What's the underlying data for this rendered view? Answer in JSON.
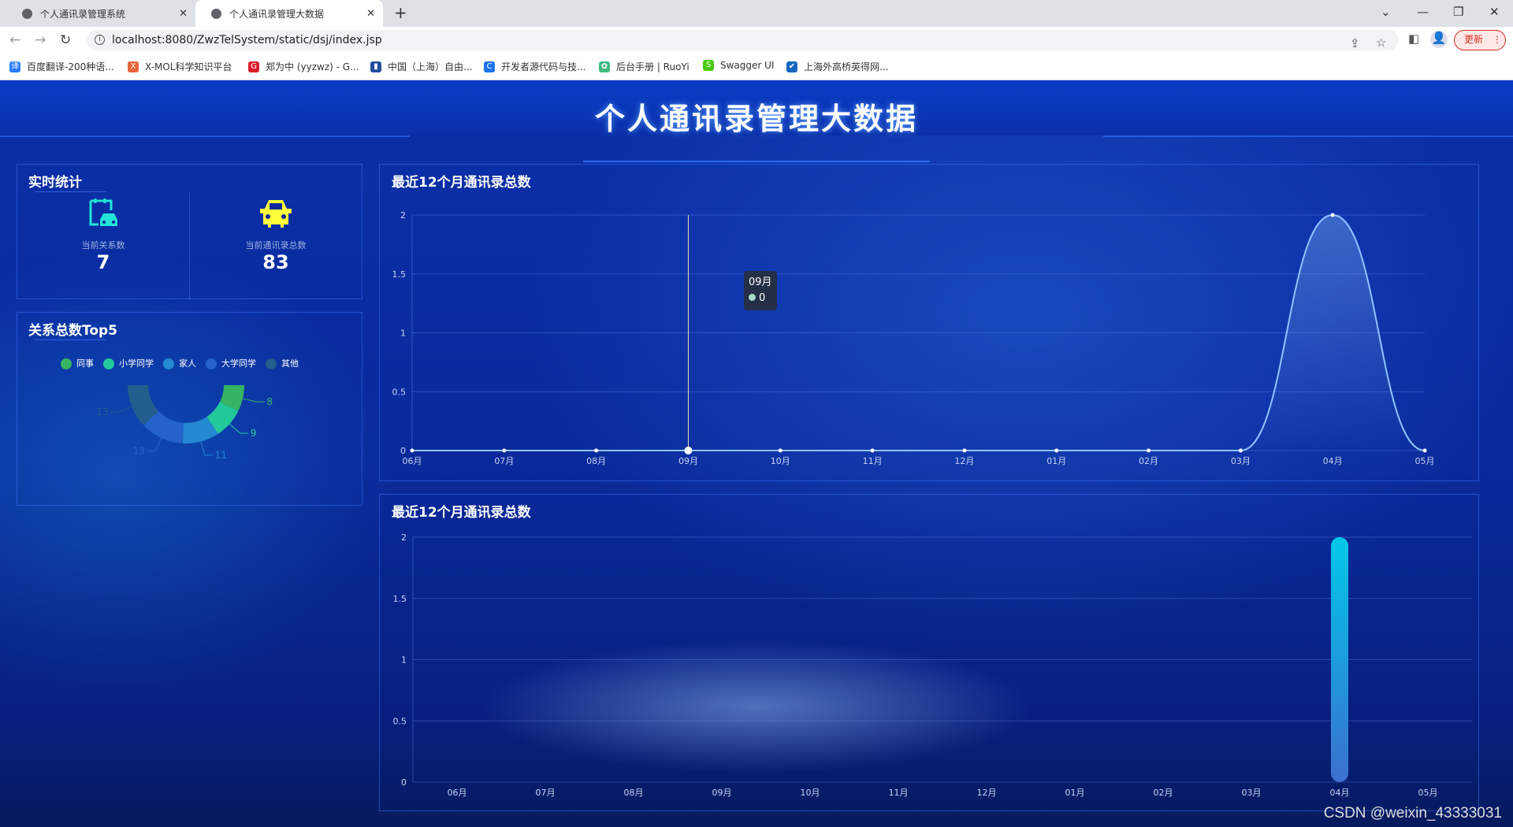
{
  "browser": {
    "tabs": [
      {
        "title": "个人通讯录管理系统",
        "active": false
      },
      {
        "title": "个人通讯录管理大数据",
        "active": true
      }
    ],
    "url": "localhost:8080/ZwzTelSystem/static/dsj/index.jsp",
    "update_label": "更新",
    "bookmarks": [
      {
        "label": "百度翻译-200种语...",
        "icon": "译",
        "color": "#2a7cf7"
      },
      {
        "label": "X-MOL科学知识平台",
        "icon": "X",
        "color": "#e8643c"
      },
      {
        "label": "郑为中 (yyzwz) - G...",
        "icon": "G",
        "color": "#d81e2c"
      },
      {
        "label": "中国（上海）自由...",
        "icon": "▮",
        "color": "#1f4e9c"
      },
      {
        "label": "开发者源代码与技...",
        "icon": "C",
        "color": "#1a73e8"
      },
      {
        "label": "后台手册 | RuoYi",
        "icon": "✿",
        "color": "#42b983"
      },
      {
        "label": "Swagger UI",
        "icon": "S",
        "color": "#49cc0c"
      },
      {
        "label": "上海外高桥英得网...",
        "icon": "✔",
        "color": "#1565c0"
      }
    ]
  },
  "page": {
    "title": "个人通讯录管理大数据",
    "realtime": {
      "title": "实时统计",
      "stats": [
        {
          "label": "当前关系数",
          "value": "7",
          "icon": "clipboard-car-icon",
          "color": "#22e3d6"
        },
        {
          "label": "当前通讯录总数",
          "value": "83",
          "icon": "car-icon",
          "color": "#ffff3c"
        }
      ]
    },
    "top5": {
      "title": "关系总数Top5"
    },
    "line_panel_title": "最近12个月通讯录总数",
    "bar_panel_title": "最近12个月通讯录总数",
    "tooltip": {
      "category": "09月",
      "value": "0"
    },
    "watermark": "CSDN @weixin_43333031"
  },
  "chart_data": [
    {
      "type": "pie",
      "variant": "half-donut",
      "legend_position": "top",
      "categories": [
        "同事",
        "小学同学",
        "家人",
        "大学同学",
        "其他"
      ],
      "values": [
        8,
        9,
        11,
        13,
        13
      ],
      "colors": [
        "#35b464",
        "#22c99a",
        "#2389d0",
        "#2562cc",
        "#235e8c"
      ]
    },
    {
      "type": "line",
      "smooth": true,
      "area": true,
      "categories": [
        "06月",
        "07月",
        "08月",
        "09月",
        "10月",
        "11月",
        "12月",
        "01月",
        "02月",
        "03月",
        "04月",
        "05月"
      ],
      "values": [
        0,
        0,
        0,
        0,
        0,
        0,
        0,
        0,
        0,
        0,
        2,
        0
      ],
      "ylim": [
        0,
        2
      ],
      "yticks": [
        "0",
        "0.5",
        "1",
        "1.5",
        "2"
      ],
      "grid": true,
      "color": "#8fc4ff"
    },
    {
      "type": "bar",
      "categories": [
        "06月",
        "07月",
        "08月",
        "09月",
        "10月",
        "11月",
        "12月",
        "01月",
        "02月",
        "03月",
        "04月",
        "05月"
      ],
      "values": [
        0,
        0,
        0,
        0,
        0,
        0,
        0,
        0,
        0,
        0,
        2,
        0
      ],
      "ylim": [
        0,
        2
      ],
      "yticks": [
        "0",
        "0.5",
        "1",
        "1.5",
        "2"
      ],
      "grid": true,
      "color_top": "#00c8e8",
      "color_bottom": "#3a70d0"
    }
  ]
}
